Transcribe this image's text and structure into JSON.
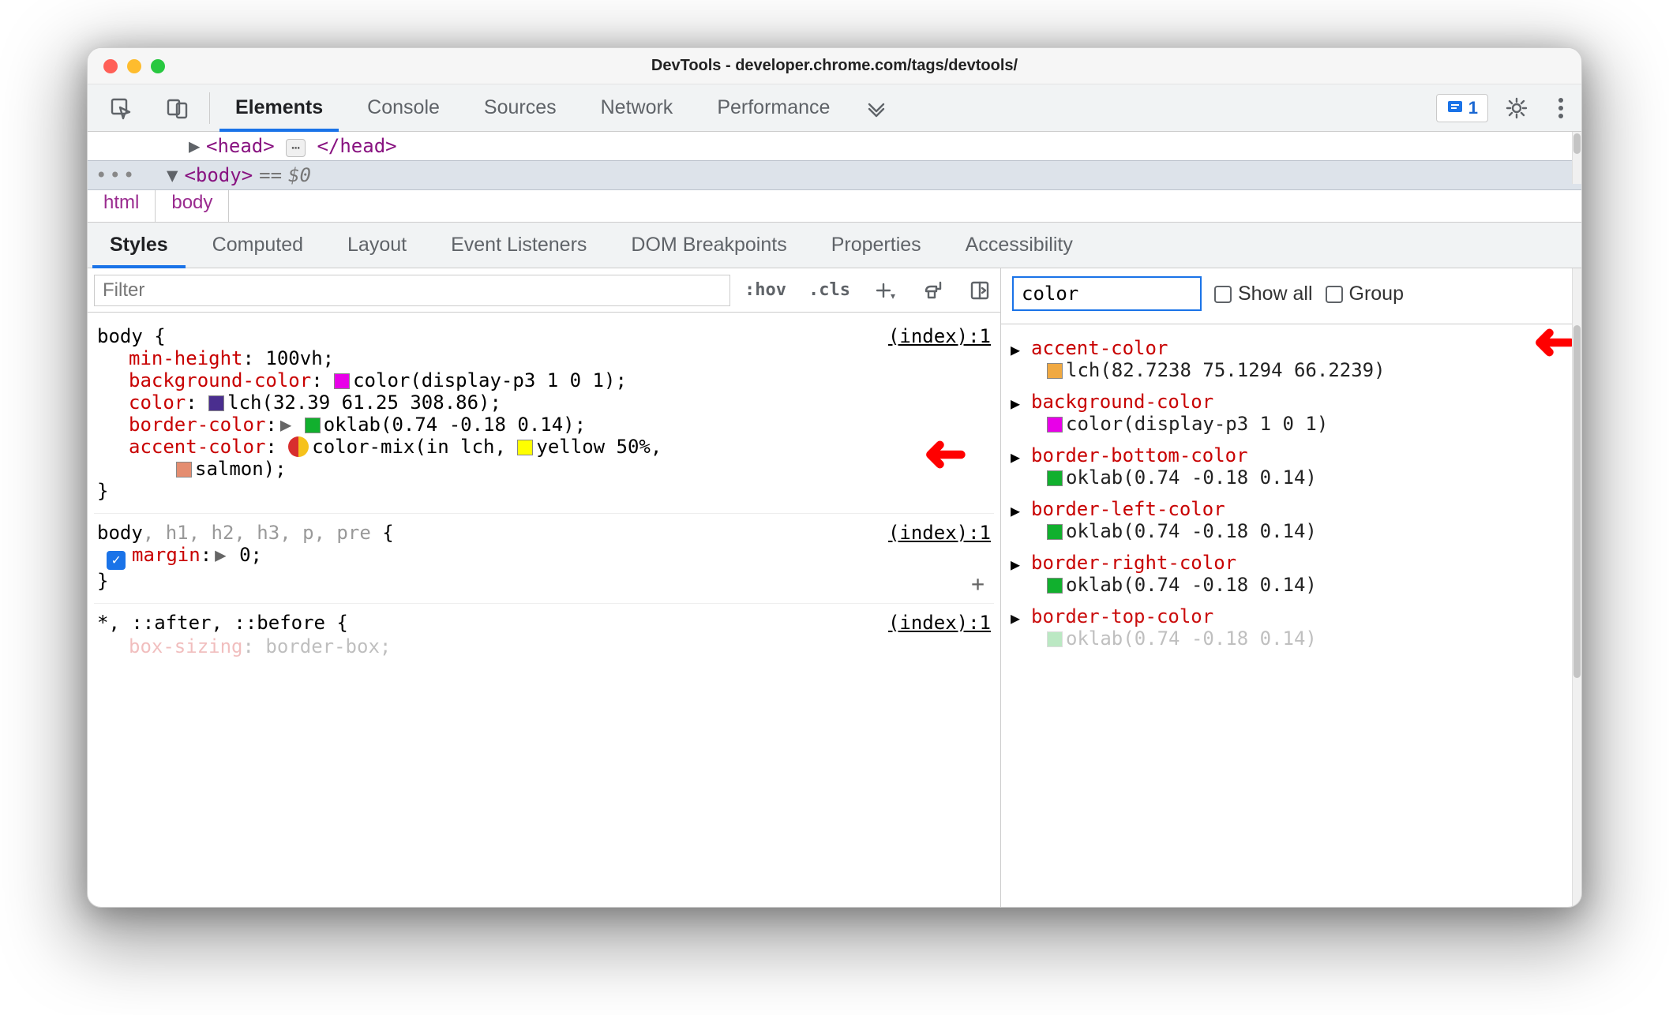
{
  "window": {
    "title": "DevTools - developer.chrome.com/tags/devtools/"
  },
  "toolbar": {
    "tabs": [
      "Elements",
      "Console",
      "Sources",
      "Network",
      "Performance"
    ],
    "active": "Elements",
    "badge_count": "1"
  },
  "tree": {
    "head_open": "<head>",
    "head_close": "</head>",
    "body_open": "<body>",
    "eq": "== ",
    "dollar": "$0"
  },
  "crumbs": [
    "html",
    "body"
  ],
  "subtabs": [
    "Styles",
    "Computed",
    "Layout",
    "Event Listeners",
    "DOM Breakpoints",
    "Properties",
    "Accessibility"
  ],
  "subtab_active": "Styles",
  "styles": {
    "filter_placeholder": "Filter",
    "actions": {
      "hov": ":hov",
      "cls": ".cls"
    },
    "rules": [
      {
        "selector": "body {",
        "source": "(index):1",
        "props": [
          {
            "name": "min-height",
            "value": "100vh"
          },
          {
            "name": "background-color",
            "swatch": "#e800e8",
            "value": "color(display-p3 1 0 1)"
          },
          {
            "name": "color",
            "swatch": "#4a2e8f",
            "value": "lch(32.39 61.25 308.86)"
          },
          {
            "name": "border-color",
            "arrow": true,
            "swatch": "#11b02e",
            "value": "oklab(0.74 -0.18 0.14)"
          },
          {
            "name": "accent-color",
            "mix": true,
            "value": "color-mix(in lch, ",
            "tail_swatch": "#ffff00",
            "tail": "yellow 50%,",
            "line2_swatch": "#e48d70",
            "line2": "salmon);"
          }
        ],
        "close": "}"
      },
      {
        "selector_parts": [
          "body",
          ", h1, h2, h3, p, pre",
          " {"
        ],
        "source": "(index):1",
        "checked_prop": {
          "name": "margin",
          "arrow": true,
          "value": "0"
        },
        "close": "}"
      },
      {
        "selector": "*, ::after, ::before {",
        "source": "(index):1",
        "partial": {
          "name": "box-sizing",
          "value": "border-box"
        }
      }
    ]
  },
  "computed": {
    "filter_value": "color",
    "show_all": "Show all",
    "group": "Group",
    "items": [
      {
        "name": "accent-color",
        "swatch": "#f0a942",
        "value": "lch(82.7238 75.1294 66.2239)"
      },
      {
        "name": "background-color",
        "swatch": "#e800e8",
        "value": "color(display-p3 1 0 1)"
      },
      {
        "name": "border-bottom-color",
        "swatch": "#11b02e",
        "value": "oklab(0.74 -0.18 0.14)"
      },
      {
        "name": "border-left-color",
        "swatch": "#11b02e",
        "value": "oklab(0.74 -0.18 0.14)"
      },
      {
        "name": "border-right-color",
        "swatch": "#11b02e",
        "value": "oklab(0.74 -0.18 0.14)"
      },
      {
        "name": "border-top-color",
        "swatch": "#11b02e",
        "value": "oklab(0.74 -0.18 0.14)"
      }
    ]
  }
}
